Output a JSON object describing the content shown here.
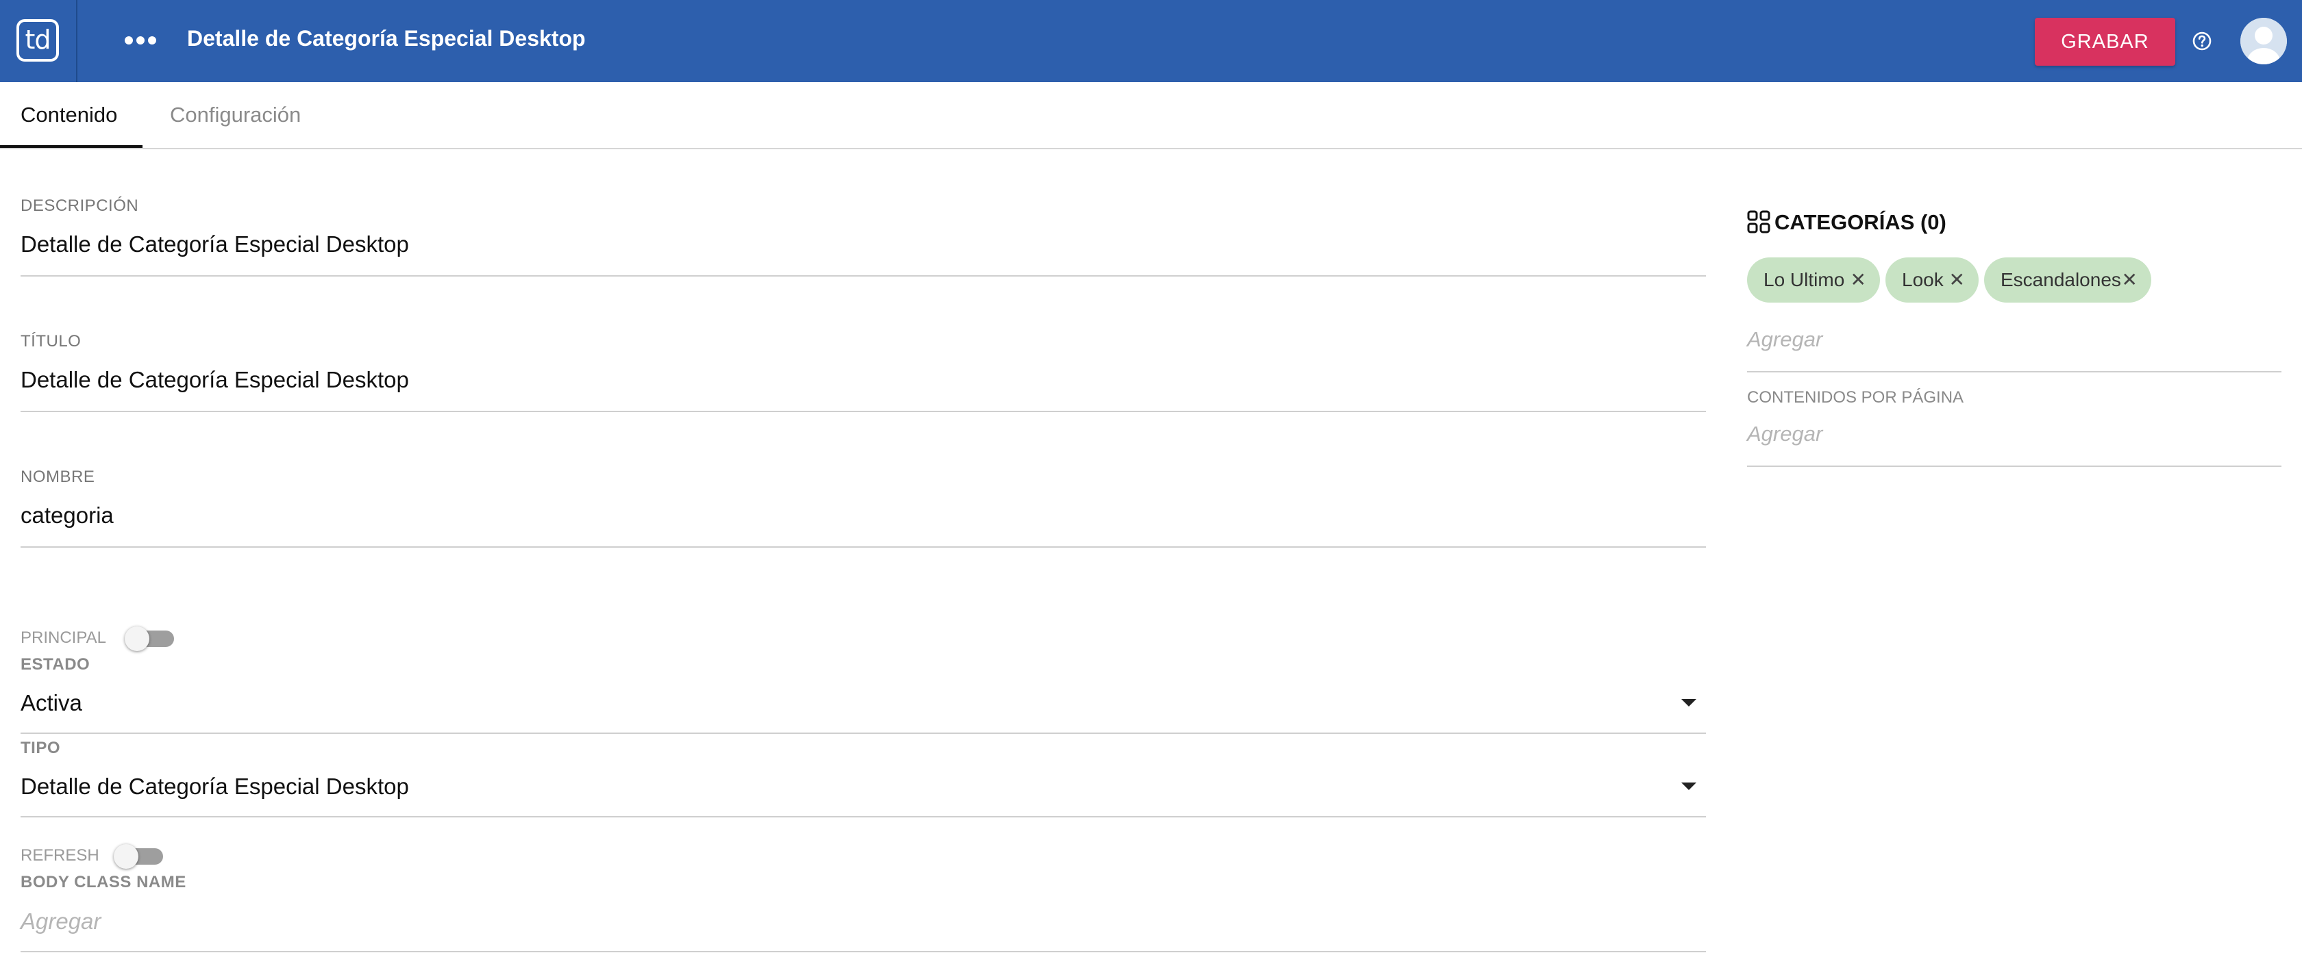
{
  "header": {
    "logo_text": "td",
    "title": "Detalle de Categoría Especial Desktop",
    "save_label": "GRABAR",
    "accent_color": "#2d5fad",
    "save_color": "#d8325f",
    "icons": [
      "menu-dots-icon",
      "help-icon",
      "avatar-icon"
    ]
  },
  "tabs": [
    {
      "label": "Contenido",
      "active": true
    },
    {
      "label": "Configuración",
      "active": false
    }
  ],
  "form": {
    "descripcion": {
      "label": "DESCRIPCIÓN",
      "value": "Detalle de Categoría Especial Desktop"
    },
    "titulo": {
      "label": "TÍTULO",
      "value": "Detalle de Categoría Especial Desktop"
    },
    "nombre": {
      "label": "NOMBRE",
      "value": "categoria"
    },
    "principal": {
      "label": "PRINCIPAL",
      "on": false
    },
    "estado": {
      "label": "ESTADO",
      "value": "Activa"
    },
    "tipo": {
      "label": "TIPO",
      "value": "Detalle de Categoría Especial Desktop"
    },
    "refresh": {
      "label": "REFRESH",
      "on": false
    },
    "body_class_name": {
      "label": "BODY CLASS NAME",
      "placeholder": "Agregar"
    }
  },
  "categories_panel": {
    "title": "CATEGORÍAS (0)",
    "chips": [
      "Lo Ultimo",
      "Look",
      "Escandalones"
    ],
    "chip_color": "#c8e3c4",
    "add_placeholder": "Agregar",
    "per_page_label": "CONTENIDOS POR PÁGINA",
    "per_page_placeholder": "Agregar"
  }
}
